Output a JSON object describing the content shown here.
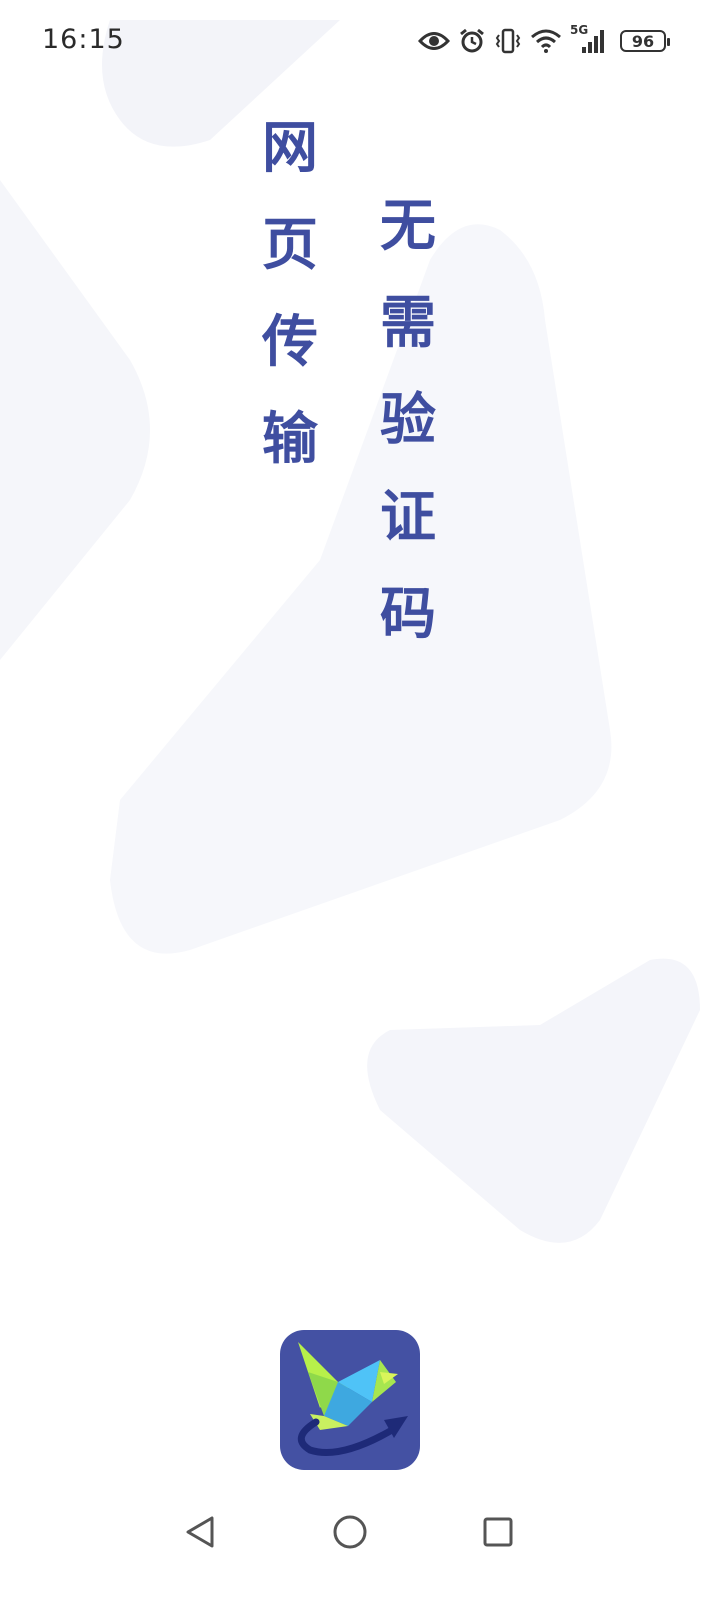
{
  "status_bar": {
    "time": "16:15",
    "network_label": "5G",
    "battery_level": "96",
    "icons": [
      "eye-icon",
      "alarm-icon",
      "vibrate-icon",
      "wifi-icon",
      "cellular-signal-icon",
      "battery-icon"
    ]
  },
  "slogans": {
    "left": "网\n页\n传\n输",
    "right": "无\n需\n验\n证\n码"
  },
  "colors": {
    "slogan": "#3f4ea0",
    "logo_bg": "#4451a3",
    "logo_green": "#b7f04a",
    "logo_cyan": "#4fc3f7",
    "logo_arrow": "#1e2a78"
  },
  "navigation": {
    "icons": [
      "back-icon",
      "home-icon",
      "recent-apps-icon"
    ]
  }
}
